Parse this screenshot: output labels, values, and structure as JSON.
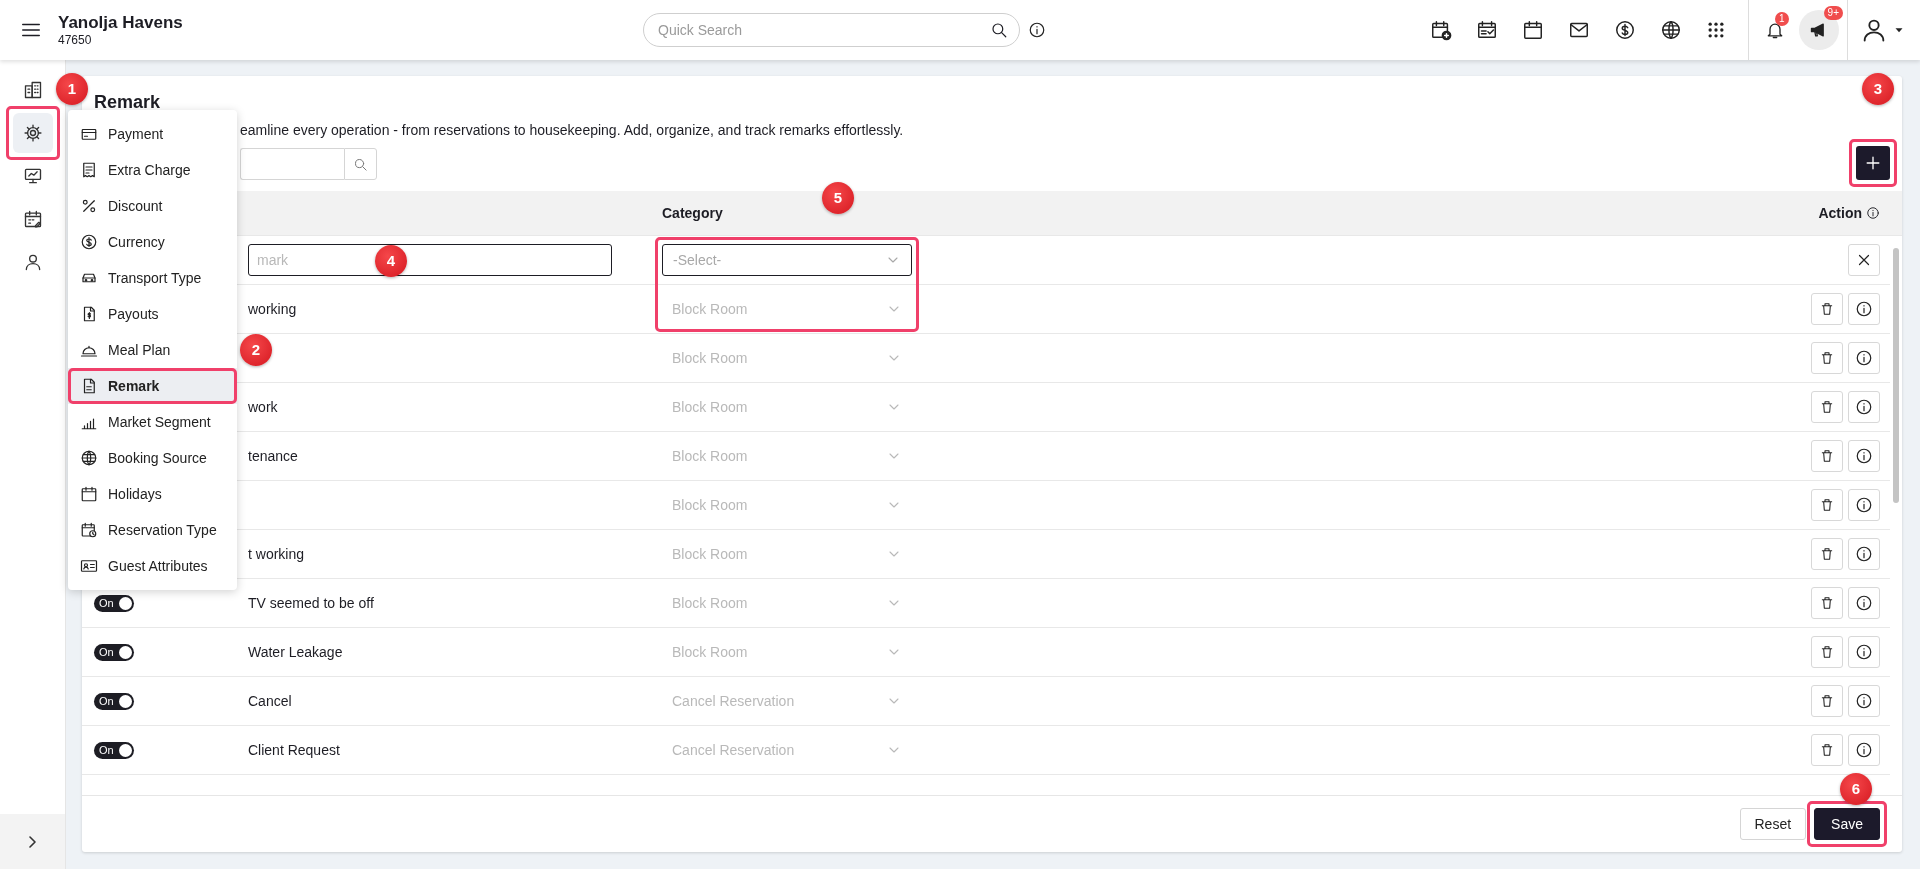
{
  "header": {
    "brand": "Yanolja Havens",
    "code": "47650",
    "search": {
      "placeholder": "Quick Search"
    },
    "notifications": {
      "badge": "1"
    },
    "announcements": {
      "badge": "9+"
    }
  },
  "sidebar": {
    "items": [
      {
        "selected": false
      },
      {
        "selected": true
      },
      {
        "selected": false
      },
      {
        "selected": false
      },
      {
        "selected": false
      }
    ]
  },
  "settings_menu": {
    "items": [
      {
        "label": "Payment",
        "selected": false
      },
      {
        "label": "Extra Charge",
        "selected": false
      },
      {
        "label": "Discount",
        "selected": false
      },
      {
        "label": "Currency",
        "selected": false
      },
      {
        "label": "Transport Type",
        "selected": false
      },
      {
        "label": "Payouts",
        "selected": false
      },
      {
        "label": "Meal Plan",
        "selected": false
      },
      {
        "label": "Remark",
        "selected": true
      },
      {
        "label": "Market Segment",
        "selected": false
      },
      {
        "label": "Booking Source",
        "selected": false
      },
      {
        "label": "Holidays",
        "selected": false
      },
      {
        "label": "Reservation Type",
        "selected": false
      },
      {
        "label": "Guest Attributes",
        "selected": false
      }
    ]
  },
  "page": {
    "title": "Remark",
    "description": "eamline every operation - from reservations to housekeeping. Add, organize, and track remarks effortlessly."
  },
  "table": {
    "columns": [
      {
        "label": "Category"
      },
      {
        "label": "Action"
      }
    ],
    "new_row": {
      "name_placeholder": "mark",
      "category_placeholder": "-Select-"
    },
    "rows": [
      {
        "name": "working",
        "category": "Block Room",
        "disabled": true
      },
      {
        "category": "Block Room",
        "disabled": true
      },
      {
        "name": "work",
        "category": "Block Room",
        "disabled": true
      },
      {
        "name": "tenance",
        "category": "Block Room",
        "disabled": true
      },
      {
        "category": "Block Room",
        "disabled": true
      },
      {
        "name": "t working",
        "category": "Block Room",
        "disabled": true
      },
      {
        "toggle": {
          "on": true,
          "label": "On"
        },
        "name": "TV seemed to be off",
        "category": "Block Room",
        "disabled": true
      },
      {
        "toggle": {
          "on": true,
          "label": "On"
        },
        "name": "Water Leakage",
        "category": "Block Room",
        "disabled": true
      },
      {
        "toggle": {
          "on": true,
          "label": "On"
        },
        "name": "Cancel",
        "category": "Cancel Reservation",
        "disabled": true
      },
      {
        "toggle": {
          "on": true,
          "label": "On"
        },
        "name": "Client Request",
        "category": "Cancel Reservation",
        "disabled": true
      }
    ]
  },
  "footer": {
    "buttons": [
      {
        "label": "Reset",
        "kind": "secondary"
      },
      {
        "label": "Save",
        "kind": "primary"
      }
    ]
  },
  "annotations": [
    {
      "number": "1",
      "frame": true
    },
    {
      "number": "2",
      "frame": true
    },
    {
      "number": "3",
      "frame": true
    },
    {
      "number": "4",
      "frame": false
    },
    {
      "number": "5",
      "frame": true
    },
    {
      "number": "6",
      "frame": true
    }
  ]
}
